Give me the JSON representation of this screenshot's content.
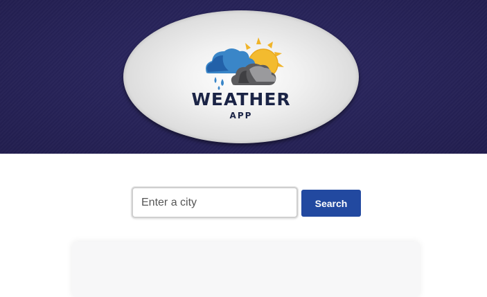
{
  "header": {
    "logo": {
      "title": "WEATHER",
      "subtitle": "APP",
      "icon": "weather-cloud-sun-rain-icon"
    }
  },
  "search": {
    "placeholder": "Enter a city",
    "value": "",
    "button_label": "Search"
  },
  "colors": {
    "header_bg": "#28245a",
    "button_bg": "#2249a0",
    "logo_text": "#1b2446"
  }
}
